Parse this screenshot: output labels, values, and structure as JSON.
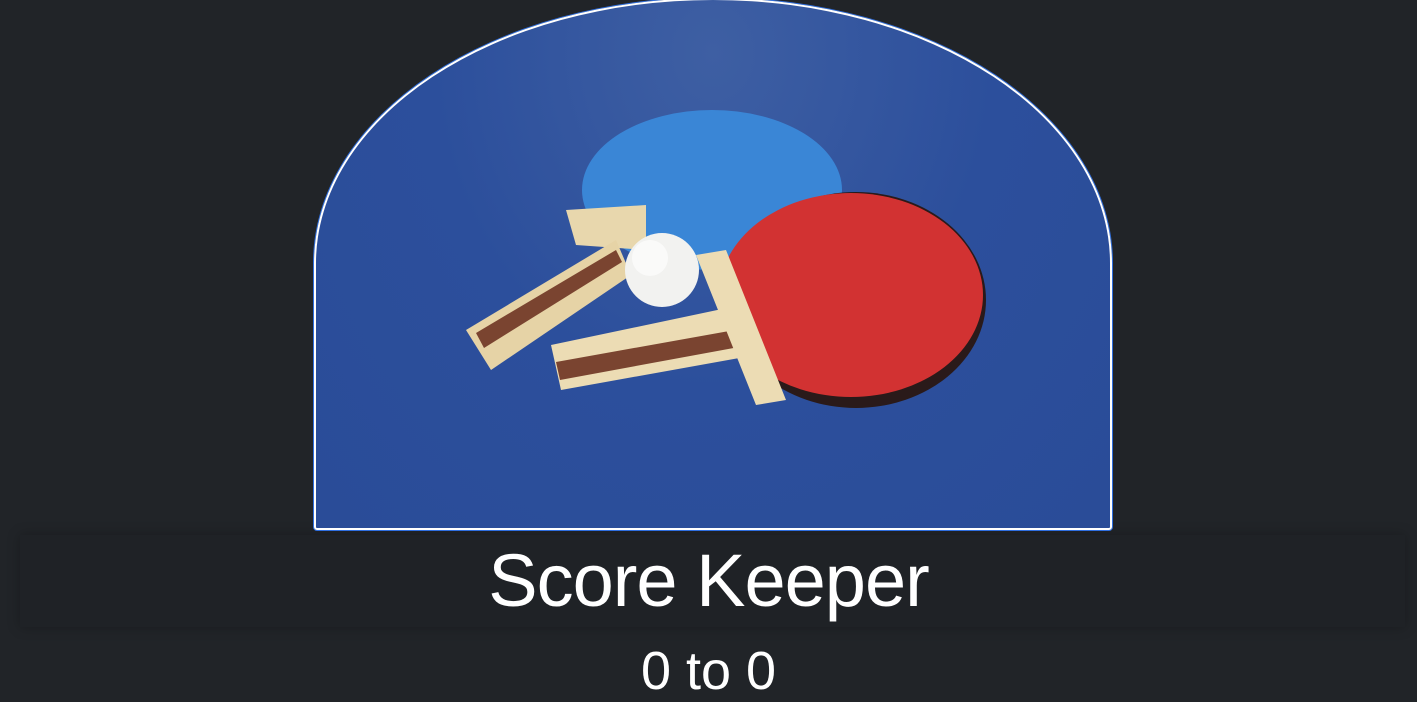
{
  "app": {
    "title": "Score Keeper",
    "score_text": "0 to 0"
  },
  "hero": {
    "image": "ping-pong-paddles-and-ball"
  },
  "colors": {
    "background": "#212428",
    "table_blue": "#2c4f9c",
    "paddle_red": "#d23232",
    "paddle_blue": "#3a86d6"
  }
}
